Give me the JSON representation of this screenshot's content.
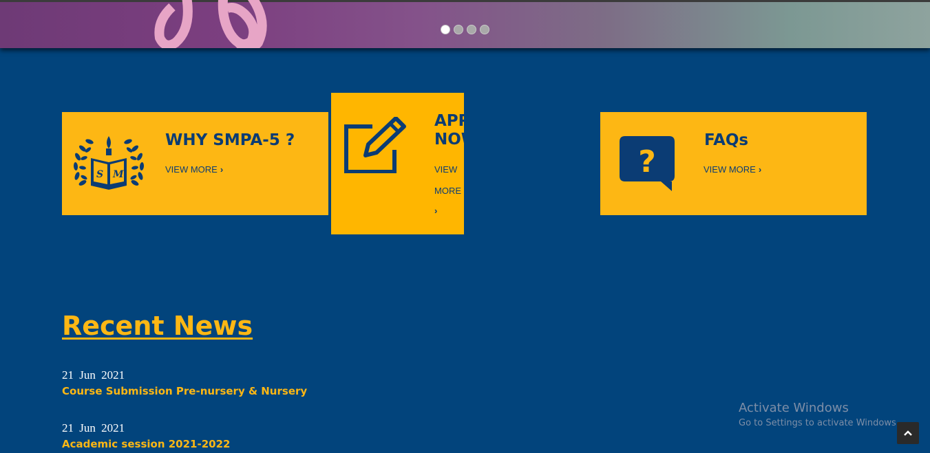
{
  "hero": {
    "slides": [
      true,
      false,
      false,
      false
    ]
  },
  "cards": {
    "why": {
      "title": "WHY SMPA-5 ?",
      "link": "VIEW MORE",
      "icon": "school-emblem-icon"
    },
    "apply": {
      "title": "APPLY NOW",
      "link_line1": "VIEW",
      "link_line2": "MORE",
      "icon": "edit-icon"
    },
    "faq": {
      "title": "FAQs",
      "link": "VIEW MORE",
      "icon": "question-bubble-icon"
    }
  },
  "news": {
    "heading": "Recent News",
    "items": [
      {
        "date": "21 Jun 2021",
        "title": "Course Submission Pre-nursery & Nursery"
      },
      {
        "date": "21 Jun 2021",
        "title": "Academic session 2021-2022"
      }
    ]
  },
  "watermark": {
    "title": "Activate Windows",
    "subtitle": "Go to Settings to activate Windows."
  },
  "colors": {
    "background": "#02447c",
    "card": "#fdb714",
    "accent_text": "#0b3c74"
  }
}
